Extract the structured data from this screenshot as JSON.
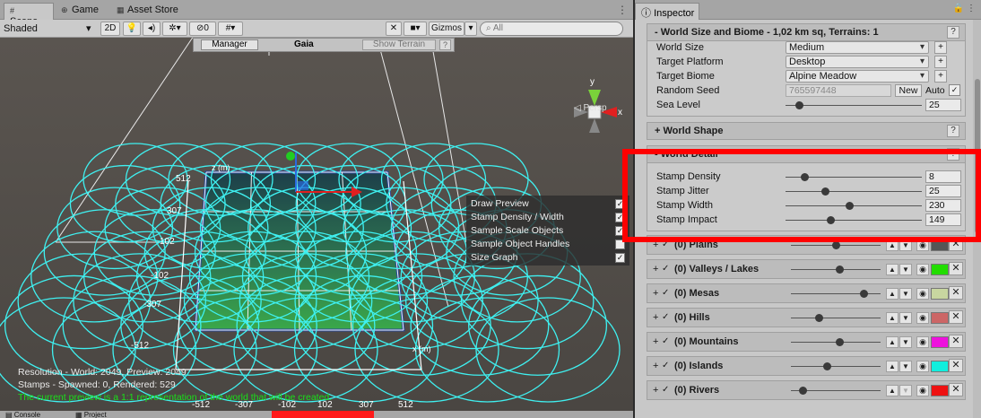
{
  "scene": {
    "tabs": [
      {
        "label": "Scene",
        "icon": "#"
      },
      {
        "label": "Game",
        "icon": "⊕"
      },
      {
        "label": "Asset Store",
        "icon": "▦"
      }
    ],
    "toolbar": {
      "shading": "Shaded",
      "mode2d": "2D",
      "hidden_count": "0",
      "gizmos": "Gizmos",
      "search_placeholder": "All"
    },
    "gaia": {
      "manager": "Manager",
      "title": "Gaia",
      "show_terrain": "Show Terrain",
      "help": "?"
    },
    "persp_label": "Persp",
    "axis_labels": [
      "y",
      "x"
    ],
    "grid_labels": {
      "z_axis": [
        "512",
        "307",
        "102",
        "-102",
        "-307",
        "-512"
      ],
      "x_axis": [
        "-512",
        "-307",
        "-102",
        "102",
        "307",
        "512"
      ],
      "x_unit": "x (m)",
      "z_unit": "z (m)"
    },
    "overlay": {
      "items": [
        {
          "label": "Draw Preview",
          "checked": true
        },
        {
          "label": "Stamp Density / Width",
          "checked": true
        },
        {
          "label": "Sample Scale Objects",
          "checked": true
        },
        {
          "label": "Sample Object Handles",
          "checked": false
        },
        {
          "label": "Size Graph",
          "checked": true
        }
      ]
    },
    "stats": {
      "line1": "Resolution - World: 2049, Preview: 2049",
      "line2": "Stamps - Spawned: 0, Rendered: 529",
      "line3": "The current preview is a 1:1 representation of the world that will be created."
    },
    "bottom_tabs": [
      "Console",
      "Project"
    ]
  },
  "inspector": {
    "tab": "Inspector",
    "world_size_section": {
      "title": "World Size and Biome - 1,02 km sq, Terrains: 1",
      "help": "?",
      "fields": [
        {
          "label": "World Size",
          "value": "Medium"
        },
        {
          "label": "Target Platform",
          "value": "Desktop"
        },
        {
          "label": "Target Biome",
          "value": "Alpine Meadow"
        }
      ],
      "random_seed": {
        "label": "Random Seed",
        "value": "765597448",
        "new_label": "New",
        "auto_label": "Auto",
        "auto_checked": true
      },
      "sea_level": {
        "label": "Sea Level",
        "value": "25",
        "fraction": 0.08
      }
    },
    "world_shape": {
      "title": "World Shape",
      "help": "?"
    },
    "world_detail": {
      "title": "World Detail",
      "help": "?",
      "sliders": [
        {
          "label": "Stamp Density",
          "value": "8",
          "fraction": 0.12
        },
        {
          "label": "Stamp Jitter",
          "value": "25",
          "fraction": 0.28
        },
        {
          "label": "Stamp Width",
          "value": "230",
          "fraction": 0.47
        },
        {
          "label": "Stamp Impact",
          "value": "149",
          "fraction": 0.32
        }
      ]
    },
    "stamps": [
      {
        "name": "(0) Plains",
        "color": "#555555",
        "fraction": 0.5
      },
      {
        "name": "(0) Valleys / Lakes",
        "color": "#22dd00",
        "fraction": 0.55
      },
      {
        "name": "(0) Mesas",
        "color": "#c8d6a0",
        "fraction": 0.85
      },
      {
        "name": "(0) Hills",
        "color": "#cc6666",
        "fraction": 0.3
      },
      {
        "name": "(0) Mountains",
        "color": "#ee11dd",
        "fraction": 0.55
      },
      {
        "name": "(0) Islands",
        "color": "#11eedd",
        "fraction": 0.4
      },
      {
        "name": "(0) Rivers",
        "color": "#ee1111",
        "fraction": 0.1
      }
    ]
  },
  "colors": {
    "wire": "#3ff0f0",
    "highlight": "#ff0000",
    "terrain_dark": "#1e3a2e",
    "terrain_green": "#3aa84a"
  }
}
